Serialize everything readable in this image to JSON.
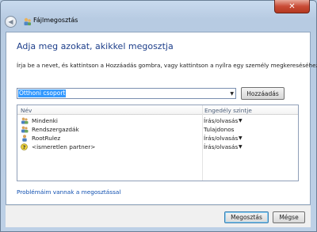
{
  "window": {
    "title": "Fájlmegosztás",
    "close_glyph": "✕",
    "back_glyph": "◀"
  },
  "dialog": {
    "heading": "Adja meg azokat, akikkel megosztja",
    "instruction": "Írja be a nevet, és kattintson a Hozzáadás gombra, vagy kattintson a nyílra egy személy megkereséséhez.",
    "name_input": {
      "value": "Otthoni csoport"
    },
    "add_button": "Hozzáadás",
    "table": {
      "headers": {
        "name": "Név",
        "permission": "Engedély szintje"
      },
      "rows": [
        {
          "name": "Mindenki",
          "permission": "Írás/olvasás",
          "has_dropdown": true,
          "icon": "users-icon"
        },
        {
          "name": "Rendszergazdák",
          "permission": "Tulajdonos",
          "has_dropdown": false,
          "icon": "users-icon"
        },
        {
          "name": "RootRulez",
          "permission": "Írás/olvasás",
          "has_dropdown": true,
          "icon": "user-icon"
        },
        {
          "name": "<ismeretlen partner>",
          "permission": "Írás/olvasás",
          "has_dropdown": true,
          "icon": "unknown-user-icon"
        }
      ]
    },
    "help_link": "Problémáim vannak a megosztással",
    "buttons": {
      "share": "Megosztás",
      "cancel": "Mégse"
    },
    "dropdown_glyph": "▼"
  },
  "colors": {
    "heading": "#1d3e8a",
    "link": "#0f4fb0",
    "selection": "#3399ff",
    "close_button": "#c94b36"
  }
}
